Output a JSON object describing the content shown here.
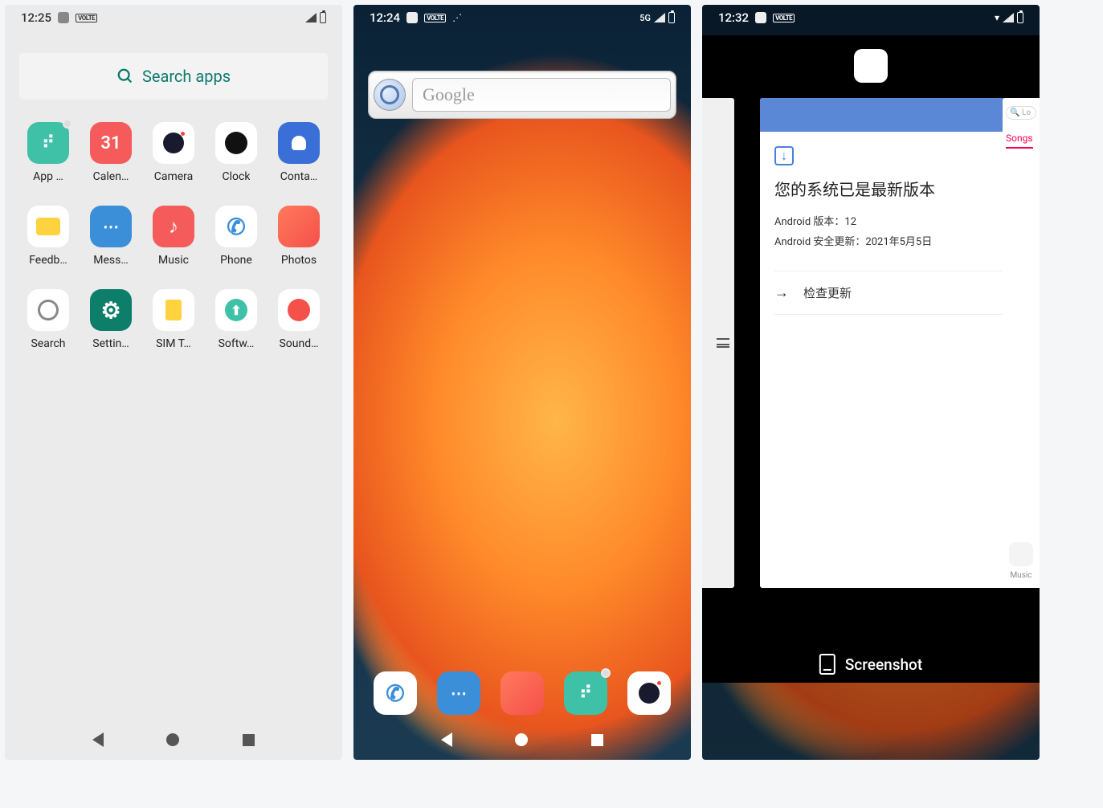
{
  "screen1": {
    "status": {
      "time": "12:25",
      "volte": "VOLTE"
    },
    "search_label": "Search apps",
    "apps": [
      {
        "label": "App …",
        "icon": "ic-appmarket",
        "notif": true
      },
      {
        "label": "Calen…",
        "icon": "ic-calendar",
        "text": "31"
      },
      {
        "label": "Camera",
        "icon": "ic-camera"
      },
      {
        "label": "Clock",
        "icon": "ic-clock"
      },
      {
        "label": "Conta…",
        "icon": "ic-contacts"
      },
      {
        "label": "Feedb…",
        "icon": "ic-feedback"
      },
      {
        "label": "Mess…",
        "icon": "ic-messages"
      },
      {
        "label": "Music",
        "icon": "ic-music"
      },
      {
        "label": "Phone",
        "icon": "ic-phone"
      },
      {
        "label": "Photos",
        "icon": "ic-photos"
      },
      {
        "label": "Search",
        "icon": "ic-search"
      },
      {
        "label": "Settin…",
        "icon": "ic-settings"
      },
      {
        "label": "SIM T…",
        "icon": "ic-sim"
      },
      {
        "label": "Softw…",
        "icon": "ic-software"
      },
      {
        "label": "Sound…",
        "icon": "ic-sound"
      }
    ]
  },
  "screen2": {
    "status": {
      "time": "12:24",
      "volte": "VOLTE",
      "net": "5G"
    },
    "google_placeholder": "Google",
    "dock": [
      {
        "icon": "ic-phone"
      },
      {
        "icon": "ic-messages"
      },
      {
        "icon": "ic-photos"
      },
      {
        "icon": "ic-appmarket",
        "notif": true
      },
      {
        "icon": "ic-camera"
      }
    ]
  },
  "screen3": {
    "status": {
      "time": "12:32",
      "volte": "VOLTE"
    },
    "update_card": {
      "title": "您的系统已是最新版本",
      "line1": "Android 版本：12",
      "line2": "Android 安全更新：2021年5月5日",
      "check": "检查更新"
    },
    "right_card": {
      "search_hint": "Lo",
      "tab": "Songs",
      "music_label": "Music"
    },
    "screenshot_label": "Screenshot"
  }
}
